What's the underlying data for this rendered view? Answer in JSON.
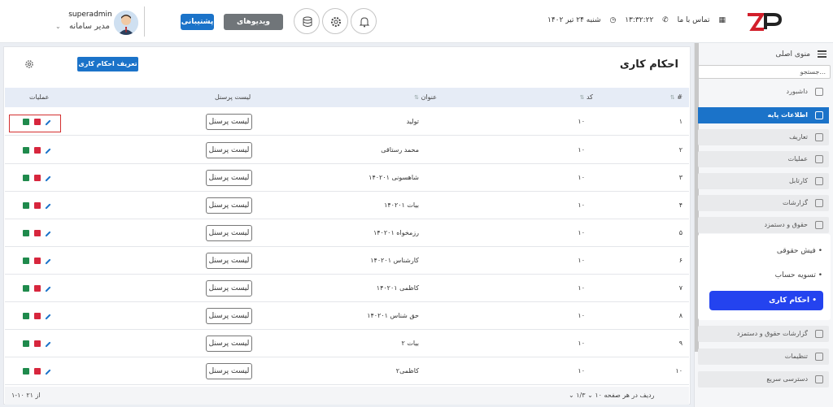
{
  "header": {
    "user": {
      "name": "superadmin",
      "role": "مدیر سامانه"
    },
    "buttons": {
      "support": "پشتیبانی",
      "videos": "ویدیوهای آموزشی"
    },
    "datetime": {
      "contact": "تماس با ما",
      "time": "۱۳:۳۲:۲۲",
      "date": "شنبه ۲۴ تیر ۱۴۰۲"
    },
    "icons": [
      "bell-icon",
      "gear-icon",
      "database-icon"
    ]
  },
  "sidebar": {
    "title": "منوی اصلی",
    "search_placeholder": "جستجو...",
    "items": {
      "dashboard": "داشبورد",
      "base_info": "اطلاعات پایه",
      "definitions": "تعاریف",
      "operations": "عملیات",
      "kartabl": "کارتابل",
      "reports": "گزارشات",
      "payroll": "حقوق و دستمزد",
      "payroll_reports": "گزارشات حقوق و دستمزد",
      "settings": "تنظیمات",
      "quick_access": "دسترسی سریع"
    },
    "payroll_sub": {
      "payslip": "فیش حقوقی",
      "settlement": "تسویه حساب",
      "work_orders": "احکام کاری"
    },
    "accent": "#1b73c9"
  },
  "main": {
    "title": "احکام کاری",
    "add_button": "تعریف احکام کاری +",
    "columns": {
      "num": "#",
      "code": "کد",
      "title": "عنوان",
      "personnel": "لیست پرسنل",
      "ops": "عملیات"
    },
    "list_button": "لیست پرسنل",
    "rows": [
      {
        "num": "۱",
        "code": "۱۰",
        "title": "تولید"
      },
      {
        "num": "۲",
        "code": "۱۰",
        "title": "محمد رستاقی"
      },
      {
        "num": "۳",
        "code": "۱۰",
        "title": "شاهسونی ۱۴۰۲۰۱"
      },
      {
        "num": "۴",
        "code": "۱۰",
        "title": "بیات ۱۴۰۲۰۱"
      },
      {
        "num": "۵",
        "code": "۱۰",
        "title": "رزمخواه ۱۴۰۲۰۱"
      },
      {
        "num": "۶",
        "code": "۱۰",
        "title": "کارشناس ۱۴۰۲۰۱"
      },
      {
        "num": "۷",
        "code": "۱۰",
        "title": "کاظمی ۱۴۰۲۰۱"
      },
      {
        "num": "۸",
        "code": "۱۰",
        "title": "حق شناس ۱۴۰۲۰۱"
      },
      {
        "num": "۹",
        "code": "۱۰",
        "title": "بیات ۲"
      },
      {
        "num": "۱۰",
        "code": "۱۰",
        "title": "کاظمی۲"
      }
    ],
    "footer": {
      "rows_per_page": "۱۰ ردیف در هر صفحه",
      "page": "۱/۳",
      "range": "۱-۱۰ از ۲۱"
    }
  }
}
